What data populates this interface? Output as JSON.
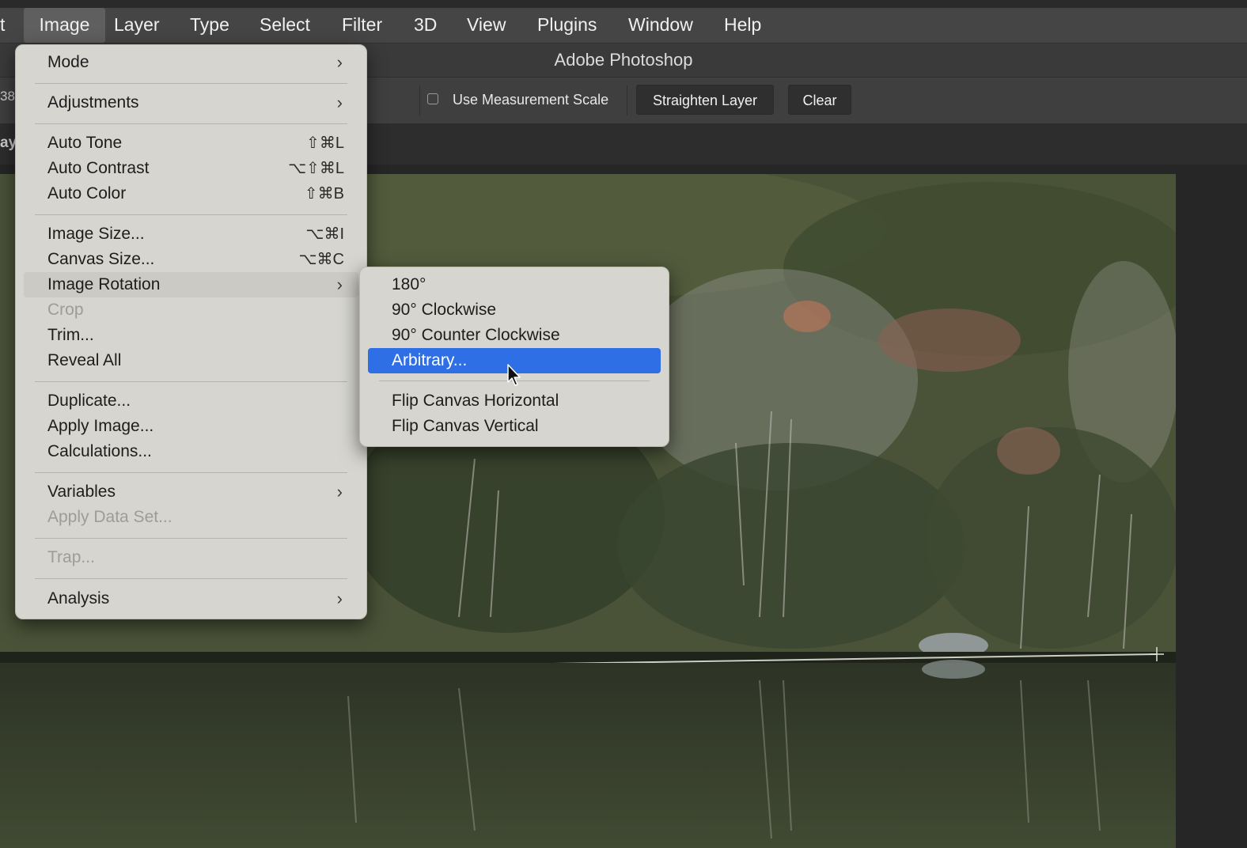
{
  "menubar": {
    "partial_left": "t",
    "items": [
      "Image",
      "Layer",
      "Type",
      "Select",
      "Filter",
      "3D",
      "View",
      "Plugins",
      "Window",
      "Help"
    ],
    "active": "Image"
  },
  "title": "Adobe Photoshop",
  "options_bar": {
    "partial_left": "38",
    "checkbox_label": "Use Measurement Scale",
    "checkbox_checked": false,
    "straighten_label": "Straighten Layer",
    "clear_label": "Clear"
  },
  "tabbar": {
    "partial_left": "ay"
  },
  "image_menu": {
    "items": [
      {
        "label": "Mode",
        "submenu": true
      },
      {
        "label": "Adjustments",
        "submenu": true
      },
      {
        "label": "Auto Tone",
        "shortcut": "⇧⌘L"
      },
      {
        "label": "Auto Contrast",
        "shortcut": "⌥⇧⌘L"
      },
      {
        "label": "Auto Color",
        "shortcut": "⇧⌘B"
      },
      {
        "label": "Image Size...",
        "shortcut": "⌥⌘I"
      },
      {
        "label": "Canvas Size...",
        "shortcut": "⌥⌘C"
      },
      {
        "label": "Image Rotation",
        "submenu": true,
        "highlighted": true
      },
      {
        "label": "Crop",
        "disabled": true
      },
      {
        "label": "Trim..."
      },
      {
        "label": "Reveal All"
      },
      {
        "label": "Duplicate..."
      },
      {
        "label": "Apply Image..."
      },
      {
        "label": "Calculations..."
      },
      {
        "label": "Variables",
        "submenu": true
      },
      {
        "label": "Apply Data Set...",
        "disabled": true
      },
      {
        "label": "Trap...",
        "disabled": true
      },
      {
        "label": "Analysis",
        "submenu": true
      }
    ]
  },
  "rotation_menu": {
    "items": [
      {
        "label": "180°"
      },
      {
        "label": "90° Clockwise"
      },
      {
        "label": "90° Counter Clockwise"
      },
      {
        "label": "Arbitrary...",
        "selected": true
      },
      {
        "label": "Flip Canvas Horizontal"
      },
      {
        "label": "Flip Canvas Vertical"
      }
    ]
  },
  "colors": {
    "selection_blue": "#2f6fe6",
    "menu_bg": "#d6d5cf",
    "app_bg": "#262626"
  }
}
